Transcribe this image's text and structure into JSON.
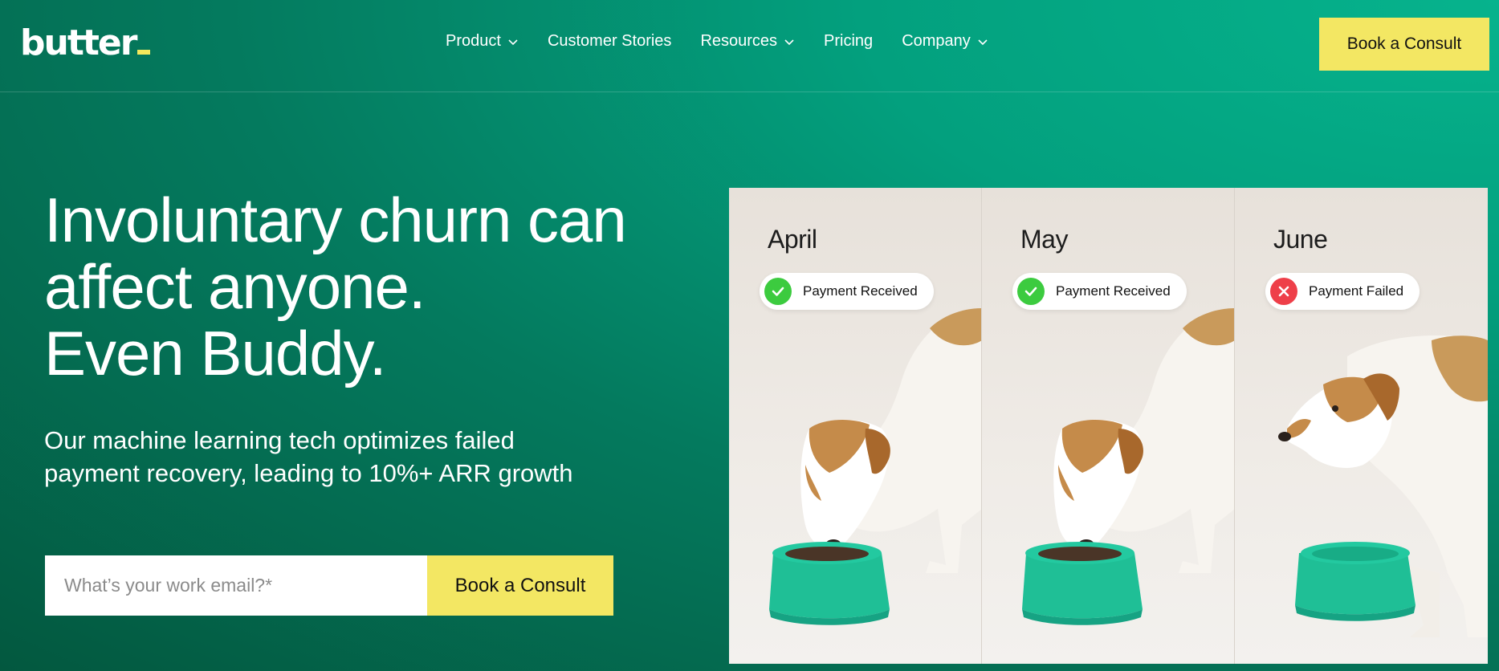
{
  "brand": {
    "logo_text": "butter"
  },
  "nav": {
    "items": [
      {
        "label": "Product",
        "has_dropdown": true
      },
      {
        "label": "Customer Stories",
        "has_dropdown": false
      },
      {
        "label": "Resources",
        "has_dropdown": true
      },
      {
        "label": "Pricing",
        "has_dropdown": false
      },
      {
        "label": "Company",
        "has_dropdown": true
      }
    ],
    "cta_label": "Book a Consult"
  },
  "hero": {
    "title_line1": "Involuntary churn can",
    "title_line2": "affect anyone.",
    "title_line3": "Even Buddy.",
    "subtitle_line1": "Our machine learning tech optimizes failed",
    "subtitle_line2": "payment recovery, leading to 10%+ ARR growth",
    "email_placeholder": "What’s your work email?*",
    "email_value": "",
    "cta_label": "Book a Consult"
  },
  "illustration": {
    "panels": [
      {
        "month": "April",
        "status": "Payment Received",
        "status_type": "success",
        "icon": "check-icon"
      },
      {
        "month": "May",
        "status": "Payment Received",
        "status_type": "success",
        "icon": "check-icon"
      },
      {
        "month": "June",
        "status": "Payment Failed",
        "status_type": "failure",
        "icon": "x-icon"
      }
    ]
  },
  "colors": {
    "accent_yellow": "#f3e763",
    "brand_green": "#03a07e",
    "success_green": "#3ccb3f",
    "failure_red": "#ee3f49",
    "bowl_teal": "#1fbf96"
  }
}
